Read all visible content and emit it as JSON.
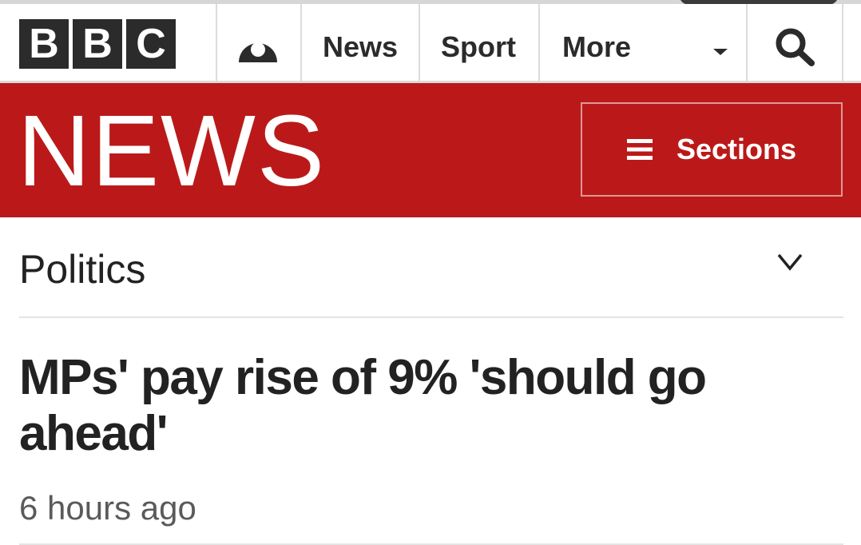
{
  "brand": {
    "letters": [
      "B",
      "B",
      "C"
    ],
    "masthead_logo": "NEWS",
    "masthead_color": "#bb1919",
    "block_color": "#2b2b2b"
  },
  "global_nav": {
    "account_icon": "account-icon",
    "items": [
      {
        "label": "News"
      },
      {
        "label": "Sport"
      },
      {
        "label": "More"
      }
    ],
    "more_icon": "caret-down-icon",
    "search_icon": "search-icon"
  },
  "sections_button": {
    "label": "Sections",
    "icon": "menu-icon"
  },
  "section_bar": {
    "title": "Politics",
    "toggle_icon": "chevron-down-icon"
  },
  "article": {
    "headline": "MPs' pay rise of 9% 'should go ahead'",
    "timestamp": "6 hours ago"
  }
}
